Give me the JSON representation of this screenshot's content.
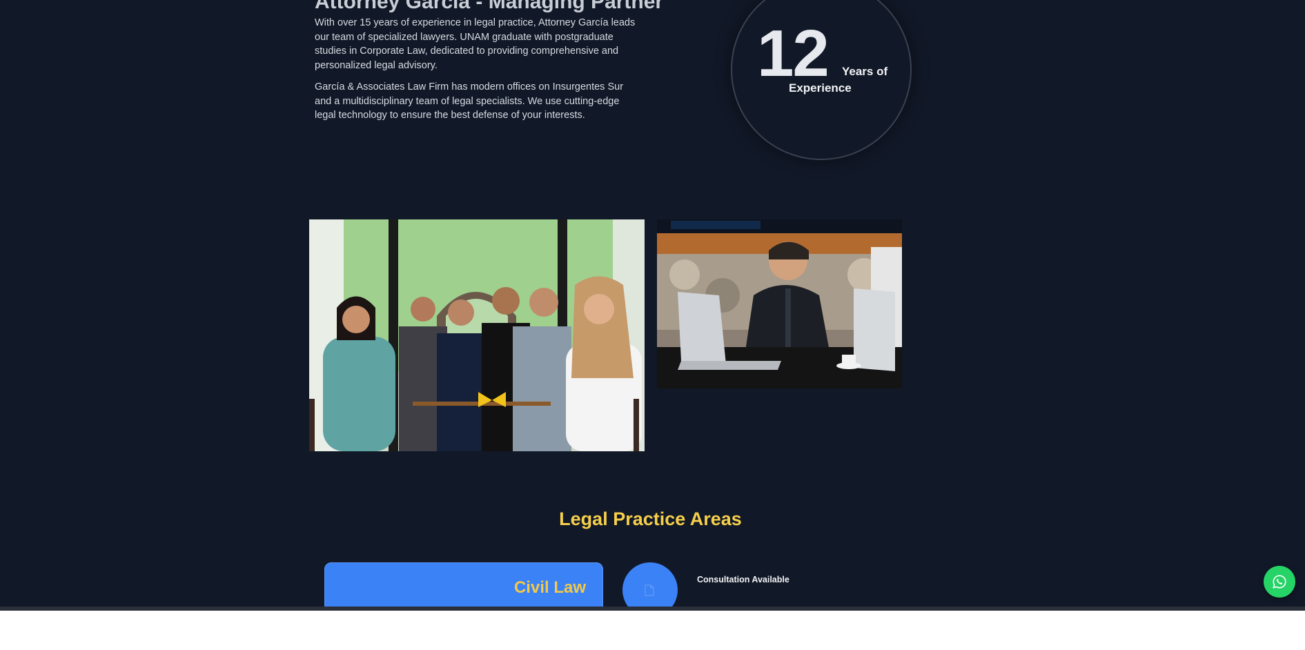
{
  "about": {
    "heading": "Attorney García - Managing Partner",
    "paragraph1": "With over 15 years of experience in legal practice, Attorney García leads our team of specialized lawyers. UNAM graduate with postgraduate studies in Corporate Law, dedicated to providing comprehensive and personalized legal advisory.",
    "paragraph2": "García & Associates Law Firm has modern offices on Insurgentes Sur and a multidisciplinary team of legal specialists. We use cutting-edge legal technology to ensure the best defense of your interests."
  },
  "experience": {
    "number": "12",
    "label_line1": "Years of",
    "label_line2": "Experience"
  },
  "practice": {
    "title": "Legal Practice Areas",
    "card_title": "Civil Law",
    "card_icon": "document-icon",
    "consultation": "Consultation Available"
  },
  "floating": {
    "icon": "whatsapp-icon"
  },
  "colors": {
    "background": "#111827",
    "accent": "#3b82f6",
    "gold": "#f6cf4b",
    "whatsapp": "#25d366"
  }
}
